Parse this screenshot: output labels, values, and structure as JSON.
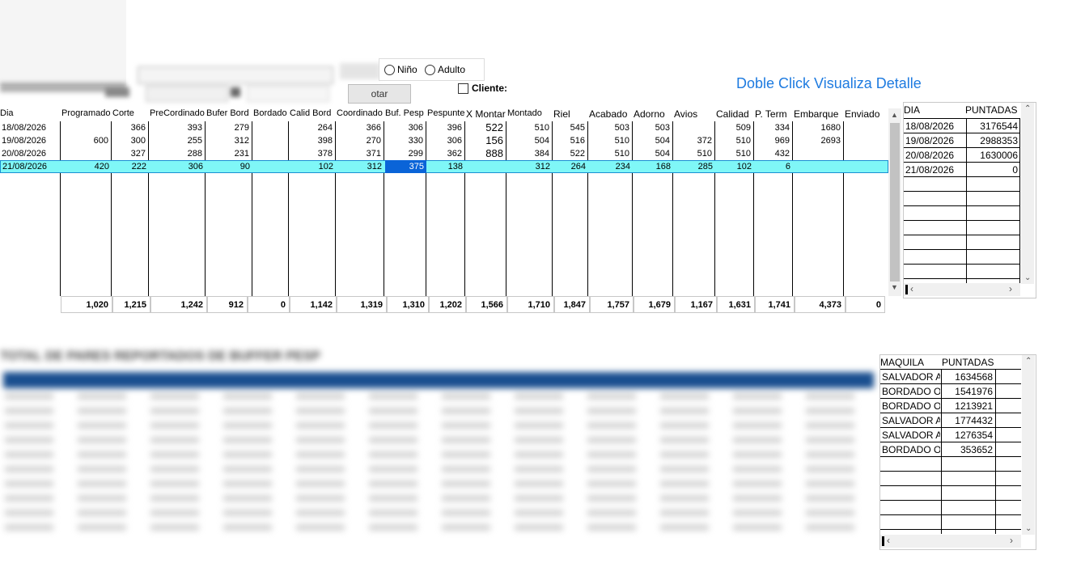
{
  "radios": {
    "nino": "Niño",
    "adulto": "Adulto"
  },
  "cliente_label": "Cliente:",
  "blurred_button_label": "otar",
  "detail_hint": "Doble Click Visualiza Detalle",
  "main_grid": {
    "columns": [
      "Dia",
      "Programado",
      "Corte",
      "PreCordinado",
      "Bufer Bord",
      "Bordado",
      "Calid Bord",
      "Coordinado",
      "Buf. Pesp",
      "Pespunte",
      "X Montar",
      "Montado",
      "Riel",
      "Acabado",
      "Adorno",
      "Avios",
      "Calidad",
      "P. Term",
      "Embarque",
      "Enviado"
    ],
    "rows": [
      [
        "18/08/2026",
        "",
        "366",
        "393",
        "279",
        "",
        "264",
        "366",
        "306",
        "396",
        "522",
        "510",
        "545",
        "503",
        "503",
        "",
        "509",
        "334",
        "1680",
        ""
      ],
      [
        "19/08/2026",
        "600",
        "300",
        "255",
        "312",
        "",
        "398",
        "270",
        "330",
        "306",
        "156",
        "504",
        "516",
        "510",
        "504",
        "372",
        "510",
        "969",
        "2693",
        ""
      ],
      [
        "20/08/2026",
        "",
        "327",
        "288",
        "231",
        "",
        "378",
        "371",
        "299",
        "362",
        "888",
        "384",
        "522",
        "510",
        "504",
        "510",
        "510",
        "432",
        "",
        ""
      ],
      [
        "21/08/2026",
        "420",
        "222",
        "306",
        "90",
        "",
        "102",
        "312",
        "375",
        "138",
        "",
        "312",
        "264",
        "234",
        "168",
        "285",
        "102",
        "6",
        "",
        ""
      ]
    ],
    "totals": [
      "1,020",
      "1,215",
      "1,242",
      "912",
      "0",
      "1,142",
      "1,319",
      "1,310",
      "1,202",
      "1,566",
      "1,710",
      "1,847",
      "1,757",
      "1,679",
      "1,167",
      "1,631",
      "1,741",
      "4,373",
      "0"
    ]
  },
  "puntadas_table": {
    "headers": [
      "DIA",
      "PUNTADAS"
    ],
    "rows": [
      [
        "18/08/2026",
        "3176544"
      ],
      [
        "19/08/2026",
        "2988353"
      ],
      [
        "20/08/2026",
        "1630006"
      ],
      [
        "21/08/2026",
        "0"
      ]
    ]
  },
  "maquila_table": {
    "headers": [
      "MAQUILA",
      "PUNTADAS"
    ],
    "rows": [
      [
        "SALVADOR A",
        "1634568"
      ],
      [
        "BORDADO O",
        "1541976"
      ],
      [
        "BORDADO O",
        "1213921"
      ],
      [
        "SALVADOR A",
        "1774432"
      ],
      [
        "SALVADOR A",
        "1276354"
      ],
      [
        "BORDADO O",
        "353652"
      ]
    ]
  },
  "bottom_blurred_title": "TOTAL DE PARES REPORTADOS DE BUFFER PESP",
  "icons": [
    "chevron-up-icon",
    "chevron-down-icon",
    "chevron-left-icon",
    "chevron-right-icon",
    "checkbox-icon",
    "radio-icon"
  ]
}
